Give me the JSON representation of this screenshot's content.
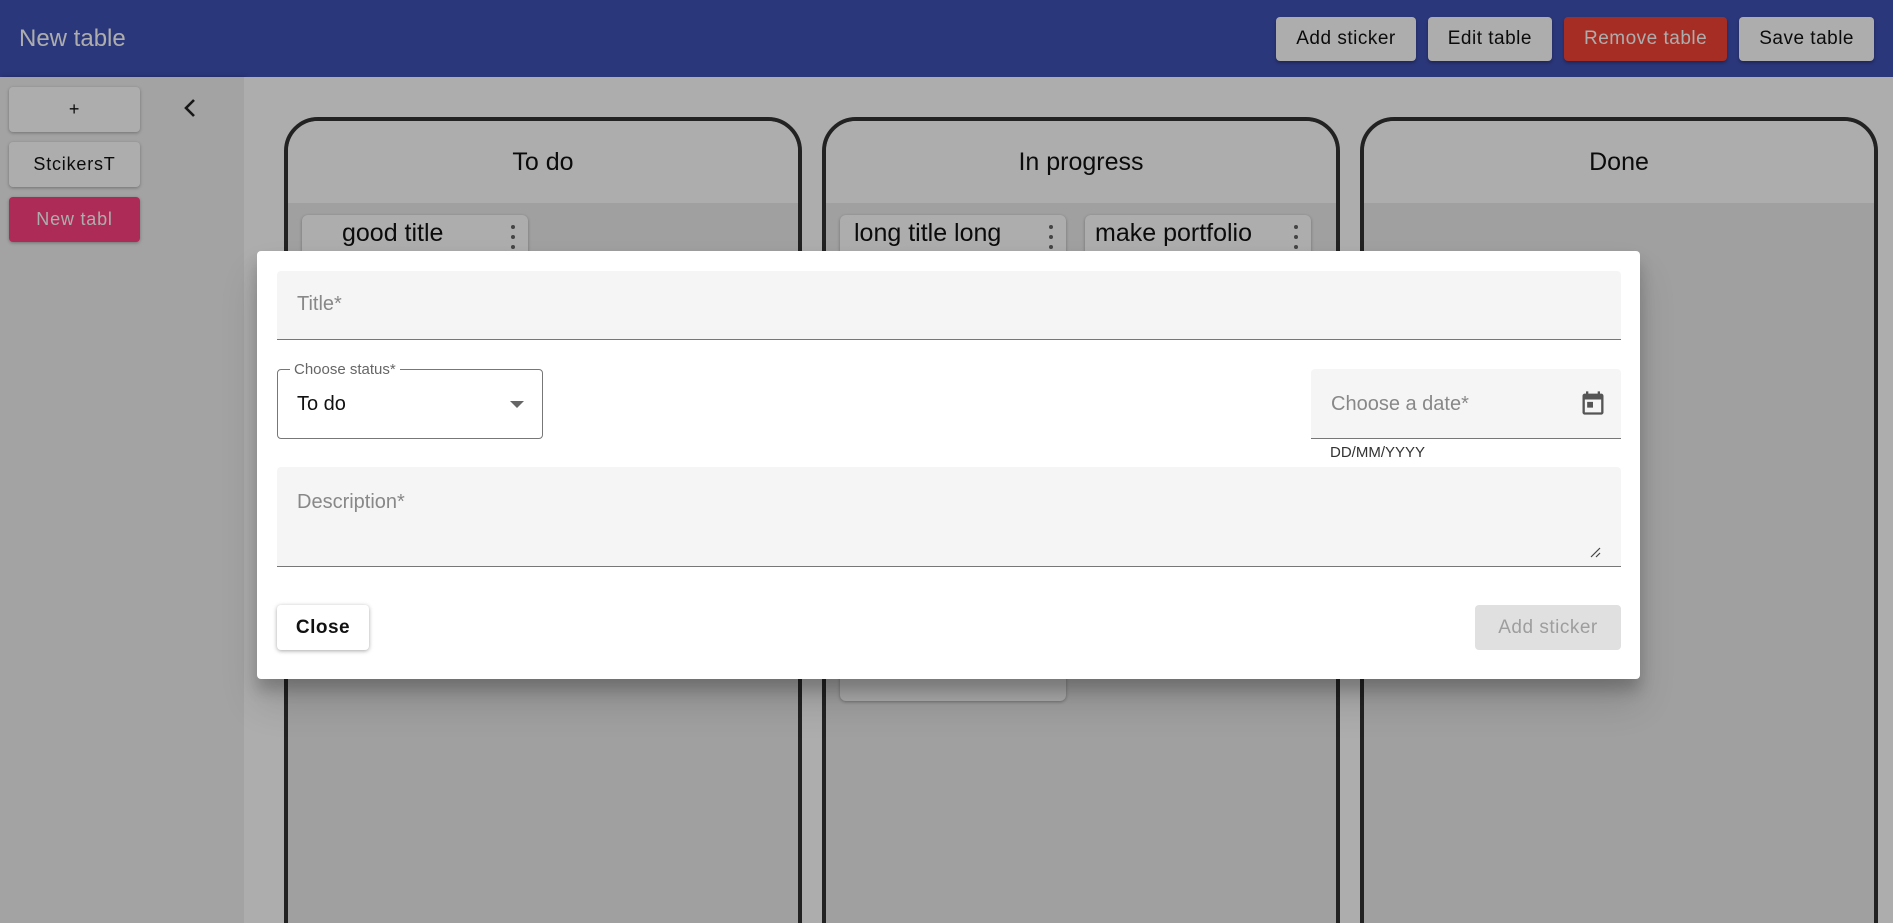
{
  "app": {
    "title": "New table"
  },
  "toolbar": {
    "add_sticker_label": "Add sticker",
    "edit_table_label": "Edit table",
    "remove_table_label": "Remove table",
    "save_table_label": "Save table"
  },
  "sidenav": {
    "add_label": "+",
    "tables": [
      {
        "label": "StcikersT"
      },
      {
        "label": "New tabl"
      }
    ]
  },
  "board": {
    "columns": [
      {
        "title": "To do",
        "stickers": [
          {
            "title": "good title"
          }
        ]
      },
      {
        "title": "In progress",
        "stickers": [
          {
            "title": "long title long"
          },
          {
            "title": "make portfolio"
          }
        ]
      },
      {
        "title": "Done",
        "stickers": []
      }
    ]
  },
  "dialog": {
    "title_placeholder": "Title*",
    "status_label": "Choose status*",
    "status_value": "To do",
    "date_placeholder": "Choose a date*",
    "date_hint": "DD/MM/YYYY",
    "description_placeholder": "Description*",
    "close_label": "Close",
    "add_label": "Add sticker"
  },
  "colors": {
    "primary": "#3f51b5",
    "accent": "#ff4081",
    "warn": "#f44336"
  },
  "icons": [
    "chevron-left-icon",
    "more-vert-icon",
    "dropdown-arrow-icon",
    "calendar-icon",
    "resize-grip-icon"
  ]
}
